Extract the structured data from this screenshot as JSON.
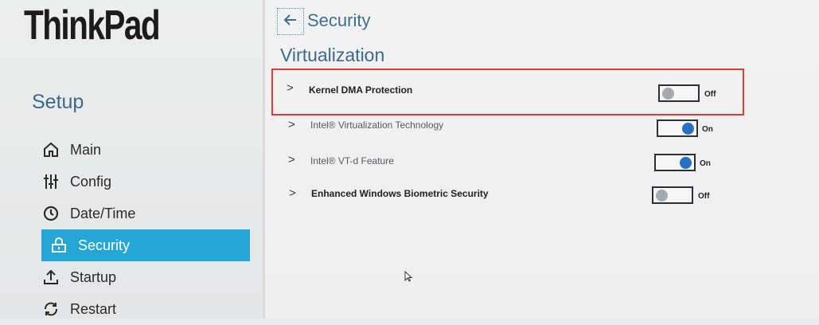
{
  "brand": {
    "logo": "ThinkPad"
  },
  "sidebar": {
    "title": "Setup",
    "items": [
      {
        "label": "Main",
        "icon": "home-icon"
      },
      {
        "label": "Config",
        "icon": "sliders-icon"
      },
      {
        "label": "Date/Time",
        "icon": "clock-icon"
      },
      {
        "label": "Security",
        "icon": "lock-icon",
        "active": true
      },
      {
        "label": "Startup",
        "icon": "upload-icon"
      },
      {
        "label": "Restart",
        "icon": "refresh-icon"
      }
    ]
  },
  "header": {
    "breadcrumb": "Security",
    "back_icon": "arrow-left-icon"
  },
  "main": {
    "section_title": "Virtualization",
    "settings": [
      {
        "label": "Kernel DMA Protection",
        "state": "Off",
        "highlighted": true
      },
      {
        "label": "Intel® Virtualization Technology",
        "state": "On"
      },
      {
        "label": "Intel® VT-d Feature",
        "state": "On"
      },
      {
        "label": "Enhanced Windows Biometric Security",
        "state": "Off"
      }
    ]
  },
  "colors": {
    "accent": "#25a6d6",
    "highlight_border": "#e23a36",
    "toggle_on": "#2a6fc2",
    "toggle_off": "#a7aaad"
  }
}
